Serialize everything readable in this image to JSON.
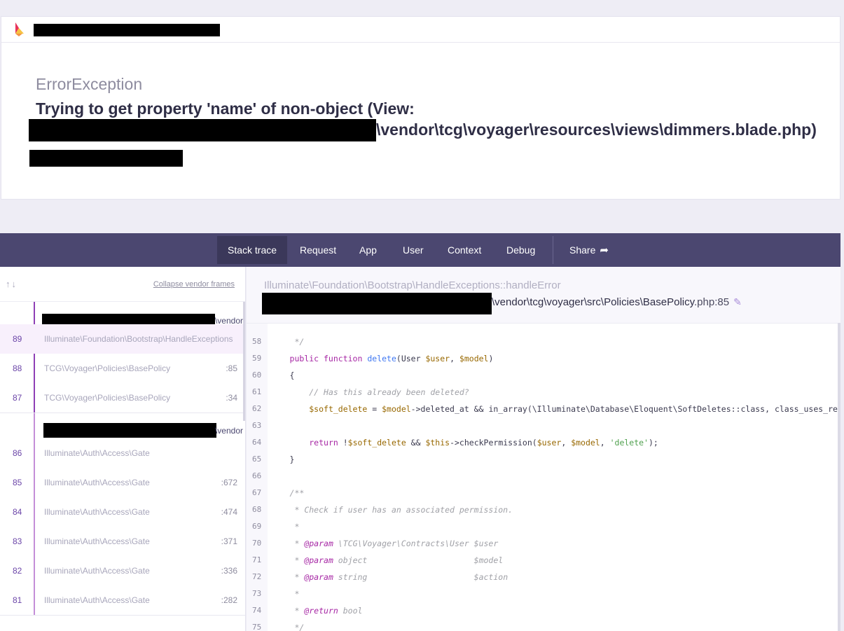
{
  "header": {
    "exception_type": "ErrorException",
    "message_line1": "Trying to get property 'name' of non-object (View:",
    "message_line2": "\\vendor\\tcg\\voyager\\resources\\views\\dimmers.blade.php)"
  },
  "tabs": [
    {
      "label": "Stack trace",
      "active": true
    },
    {
      "label": "Request"
    },
    {
      "label": "App"
    },
    {
      "label": "User"
    },
    {
      "label": "Context"
    },
    {
      "label": "Debug"
    },
    {
      "label": "Share"
    }
  ],
  "stack": {
    "arrows": "↑↓",
    "collapse_label": "Collapse vendor frames",
    "groups": [
      {
        "vendor_label": "\\vendor",
        "frames": [
          {
            "num": "89",
            "cls": "Illuminate\\Foundation\\Bootstrap\\HandleExceptions",
            "line": ""
          },
          {
            "num": "88",
            "cls": "TCG\\Voyager\\Policies\\BasePolicy",
            "line": ":85"
          },
          {
            "num": "87",
            "cls": "TCG\\Voyager\\Policies\\BasePolicy",
            "line": ":34"
          }
        ]
      },
      {
        "vendor_label": "\\vendor",
        "frames": [
          {
            "num": "86",
            "cls": "Illuminate\\Auth\\Access\\Gate",
            "line": ""
          },
          {
            "num": "85",
            "cls": "Illuminate\\Auth\\Access\\Gate",
            "line": ":672"
          },
          {
            "num": "84",
            "cls": "Illuminate\\Auth\\Access\\Gate",
            "line": ":474"
          },
          {
            "num": "83",
            "cls": "Illuminate\\Auth\\Access\\Gate",
            "line": ":371"
          },
          {
            "num": "82",
            "cls": "Illuminate\\Auth\\Access\\Gate",
            "line": ":336"
          },
          {
            "num": "81",
            "cls": "Illuminate\\Auth\\Access\\Gate",
            "line": ":282"
          }
        ]
      }
    ]
  },
  "frame_detail": {
    "class": "Illuminate\\Foundation\\Bootstrap\\HandleExceptions",
    "method": "::handleError",
    "file": "\\vendor\\tcg\\voyager\\src\\Policies\\BasePolicy",
    "file_line": ".php:85"
  },
  "code_lines": [
    {
      "n": "58",
      "html": "       <span class='cm'>*/</span>"
    },
    {
      "n": "59",
      "html": "      <span class='kw'>public function</span> <span class='fn'>delete</span>(User <span class='var'>$user</span>, <span class='var'>$model</span>)"
    },
    {
      "n": "60",
      "html": "      {"
    },
    {
      "n": "61",
      "html": "          <span class='cm'>// Has this already been deleted?</span>"
    },
    {
      "n": "62",
      "html": "          <span class='var'>$soft_delete</span> = <span class='var'>$model</span>-&gt;deleted_at &amp;&amp; in_array(\\Illuminate\\Database\\Eloquent\\SoftDeletes::class, class_uses_recursive(<span class='var'>$model</span>));"
    },
    {
      "n": "63",
      "html": ""
    },
    {
      "n": "64",
      "html": "          <span class='kw'>return</span> !<span class='var'>$soft_delete</span> &amp;&amp; <span class='var'>$this</span>-&gt;checkPermission(<span class='var'>$user</span>, <span class='var'>$model</span>, <span class='str'>'delete'</span>);"
    },
    {
      "n": "65",
      "html": "      }"
    },
    {
      "n": "66",
      "html": ""
    },
    {
      "n": "67",
      "html": "      <span class='cm'>/**</span>"
    },
    {
      "n": "68",
      "html": "       <span class='cm'>* Check if user has an associated permission.</span>"
    },
    {
      "n": "69",
      "html": "       <span class='cm'>*</span>"
    },
    {
      "n": "70",
      "html": "       <span class='cm'>* </span><span class='doc'>@param</span><span class='cm'> \\TCG\\Voyager\\Contracts\\User $user</span>"
    },
    {
      "n": "71",
      "html": "       <span class='cm'>* </span><span class='doc'>@param</span><span class='cm'> object                      $model</span>"
    },
    {
      "n": "72",
      "html": "       <span class='cm'>* </span><span class='doc'>@param</span><span class='cm'> string                      $action</span>"
    },
    {
      "n": "73",
      "html": "       <span class='cm'>*</span>"
    },
    {
      "n": "74",
      "html": "       <span class='cm'>* </span><span class='doc'>@return</span><span class='cm'> bool</span>"
    },
    {
      "n": "75",
      "html": "       <span class='cm'>*/</span>"
    }
  ],
  "colors": {
    "tabbar": "#4b4770",
    "accent": "#8e3fb5",
    "background": "#eeedf5"
  }
}
